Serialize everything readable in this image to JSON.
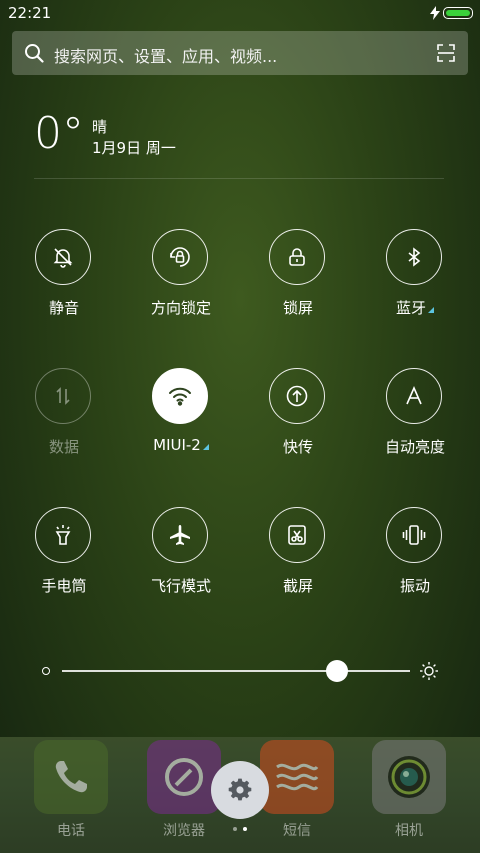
{
  "status_bar": {
    "time": "22:21",
    "battery_level": 1.0,
    "charging": true,
    "battery_color": "#3ad13a"
  },
  "search": {
    "placeholder": "搜索网页、设置、应用、视频...",
    "icons": [
      "search-icon",
      "scan-icon"
    ]
  },
  "weather": {
    "temperature": "0°",
    "condition": "晴",
    "date": "1月9日 周一"
  },
  "toggles": [
    {
      "label": "静音",
      "icon": "bell-off-icon",
      "state": "off"
    },
    {
      "label": "方向锁定",
      "icon": "rotation-lock-icon",
      "state": "off"
    },
    {
      "label": "锁屏",
      "icon": "lock-icon",
      "state": "off"
    },
    {
      "label": "蓝牙",
      "icon": "bluetooth-icon",
      "state": "off",
      "expandable": true
    },
    {
      "label": "数据",
      "icon": "data-arrows-icon",
      "state": "disabled"
    },
    {
      "label": "MIUI-2",
      "icon": "wifi-icon",
      "state": "on",
      "expandable": true
    },
    {
      "label": "快传",
      "icon": "upload-icon",
      "state": "off"
    },
    {
      "label": "自动亮度",
      "icon": "letter-a-icon",
      "state": "off"
    },
    {
      "label": "手电筒",
      "icon": "flashlight-icon",
      "state": "off"
    },
    {
      "label": "飞行模式",
      "icon": "airplane-icon",
      "state": "off"
    },
    {
      "label": "截屏",
      "icon": "screenshot-scissors-icon",
      "state": "off"
    },
    {
      "label": "振动",
      "icon": "vibrate-icon",
      "state": "off"
    }
  ],
  "brightness": {
    "level": 0.79
  },
  "dock": {
    "apps": [
      {
        "name": "电话",
        "icon": "phone-icon",
        "color": "#4b6a2a"
      },
      {
        "name": "浏览器",
        "icon": "browser-icon",
        "color": "#7b2a8f"
      },
      {
        "name": "短信",
        "icon": "message-icon",
        "color": "#d34b1e"
      },
      {
        "name": "相机",
        "icon": "camera-icon",
        "color": "#7a7a7a"
      }
    ],
    "settings_icon": "gear-icon",
    "pages": 2,
    "current_page": 2
  }
}
